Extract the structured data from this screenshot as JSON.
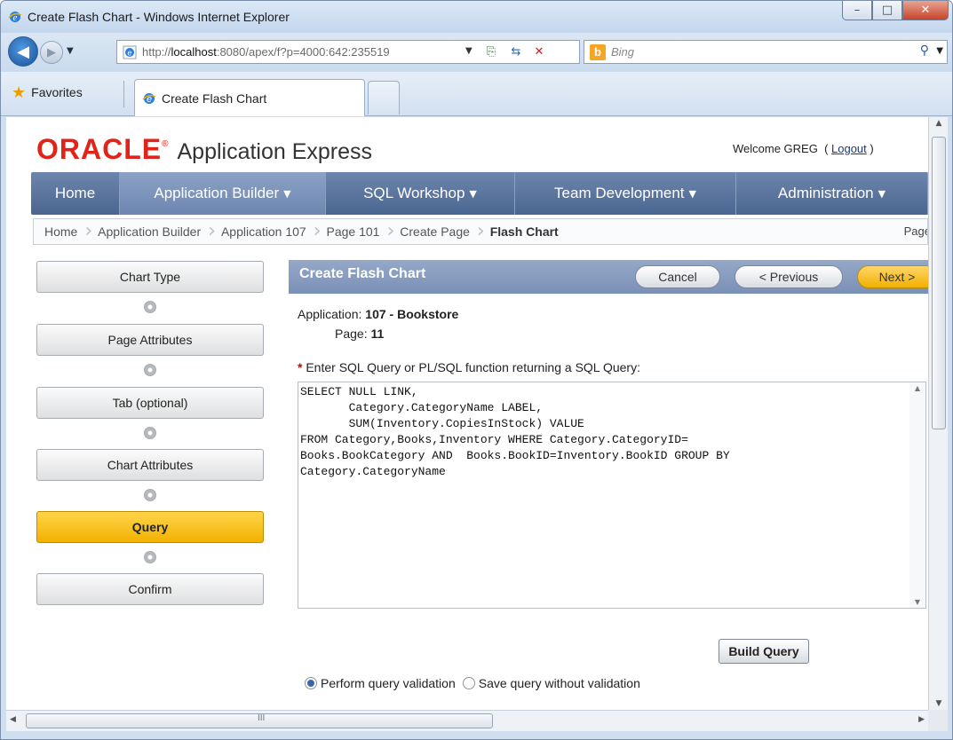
{
  "window": {
    "title": "Create Flash Chart - Windows Internet Explorer"
  },
  "address": {
    "url_prefix": "http://",
    "url_host": "localhost",
    "url_rest": ":8080/apex/f?p=4000:642:235519"
  },
  "search": {
    "placeholder": "Bing"
  },
  "favorites": {
    "label": "Favorites"
  },
  "tab": {
    "label": "Create Flash Chart"
  },
  "header": {
    "brand": "ORACLE",
    "product": "Application Express",
    "welcome": "Welcome GREG",
    "logout": "Logout"
  },
  "nav": [
    {
      "label": "Home",
      "caret": false
    },
    {
      "label": "Application Builder",
      "caret": true
    },
    {
      "label": "SQL Workshop",
      "caret": true
    },
    {
      "label": "Team Development",
      "caret": true
    },
    {
      "label": "Administration",
      "caret": true
    }
  ],
  "breadcrumbs": [
    "Home",
    "Application Builder",
    "Application 107",
    "Page 101",
    "Create Page",
    "Flash Chart"
  ],
  "breadcrumb_right": "Page",
  "steps": [
    "Chart Type",
    "Page Attributes",
    "Tab (optional)",
    "Chart Attributes",
    "Query",
    "Confirm"
  ],
  "active_step": "Query",
  "region": {
    "title": "Create Flash Chart",
    "cancel": "Cancel",
    "previous": "< Previous",
    "next": "Next >",
    "application_label": "Application:",
    "application_value": "107 - Bookstore",
    "page_label": "Page:",
    "page_value": "11",
    "query_label": "Enter SQL Query or PL/SQL function returning a SQL Query:",
    "sql": "SELECT NULL LINK,\n       Category.CategoryName LABEL,\n       SUM(Inventory.CopiesInStock) VALUE\nFROM Category,Books,Inventory WHERE Category.CategoryID=\nBooks.BookCategory AND  Books.BookID=Inventory.BookID GROUP BY\nCategory.CategoryName",
    "build_query": "Build Query",
    "radio_validate": "Perform query validation",
    "radio_no_validate": "Save query without validation",
    "selected_option": "Perform query validation"
  },
  "scrollbar": {
    "grip": "III"
  },
  "colors": {
    "oracle_red": "#e2231a",
    "nav_blue": "#5a7399",
    "active_step": "#f5b800"
  }
}
